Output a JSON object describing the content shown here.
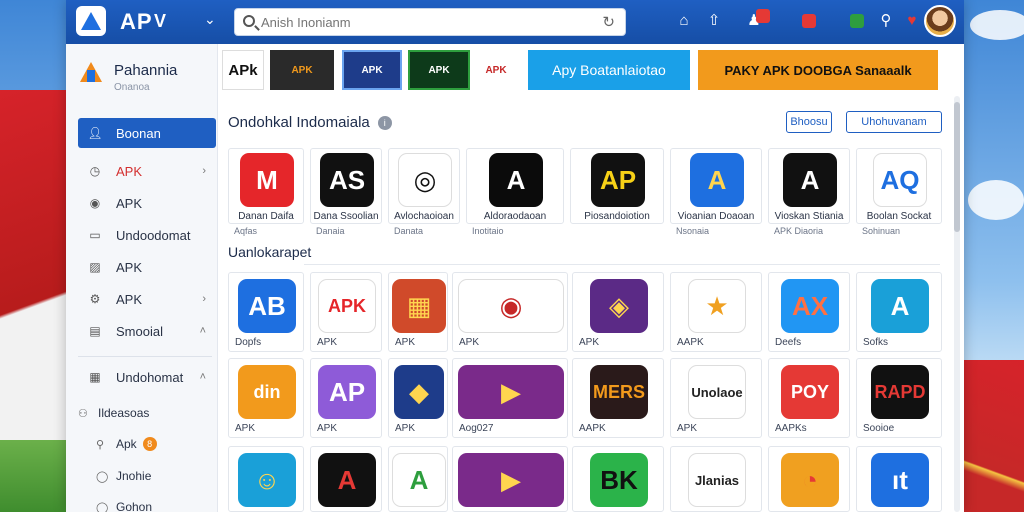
{
  "topbar": {
    "title": "AP",
    "search_placeholder": "Anish Inonianm",
    "title_suffix": "V"
  },
  "sidebar": {
    "brand_name": "Pahannia",
    "brand_sub": "Onanoa",
    "items": [
      {
        "label": "Boonan",
        "icon": "user-icon",
        "active": true
      },
      {
        "label": "APK",
        "icon": "clock-icon",
        "chevron": true,
        "accent": "#d32f2f"
      },
      {
        "label": "APK",
        "icon": "circle-icon"
      },
      {
        "label": "Undoodomat",
        "icon": "folder-icon"
      },
      {
        "label": "APK",
        "icon": "chart-icon"
      },
      {
        "label": "APK",
        "icon": "settings-icon",
        "chevron": true
      },
      {
        "label": "Smooial",
        "icon": "list-icon",
        "chevron_up": true
      }
    ],
    "group": {
      "label": "Undohomat",
      "icon": "calendar-icon"
    },
    "subitems": [
      {
        "label": "Ildeasoas",
        "icon": "people-icon"
      },
      {
        "label": "Apk",
        "icon": "search-icon",
        "badge": "8"
      },
      {
        "label": "Jnohie",
        "icon": "circle-icon"
      },
      {
        "label": "Gohon",
        "icon": "circle-icon"
      }
    ]
  },
  "banner": {
    "tiles": [
      {
        "text": "APk"
      },
      {
        "text": "APK"
      },
      {
        "text": "APK"
      },
      {
        "text": "APK"
      },
      {
        "text": "APK"
      },
      {
        "text": "Apy  Boatanlaiotao"
      },
      {
        "text": "PAKY  APK DOOBGA  Sanaaalk"
      }
    ]
  },
  "section1": {
    "title": "Ondohkal Indomaiala",
    "info": "i",
    "btn1": "Bhoosu",
    "btn2": "Uhohuvanam",
    "apps": [
      {
        "icon_text": "M",
        "name": "Danan Daifa",
        "sub": "Aqfas",
        "color": "#e5262a",
        "fg": "#ffffff"
      },
      {
        "icon_text": "AS",
        "name": "Dana Ssoolian",
        "sub": "Danaia",
        "color": "#111111",
        "fg": "#ffffff"
      },
      {
        "icon_text": "◎",
        "name": "Avlochaoioan",
        "sub": "Danata",
        "color": "#ffffff",
        "fg": "#111111"
      },
      {
        "icon_text": "A",
        "name": "Aldoraodaoan",
        "sub": "Inotitaio",
        "color": "#0b0b0b",
        "fg": "#ffffff"
      },
      {
        "icon_text": "AP",
        "name": "Piosandoiotion",
        "sub": "",
        "color": "#111111",
        "fg": "#f7d117"
      },
      {
        "icon_text": "A",
        "name": "Vioanian Doaoan",
        "sub": "Nsonaia",
        "color": "#1e6fe0",
        "fg": "#ffd54f"
      },
      {
        "icon_text": "A",
        "name": "Vioskan Stiania",
        "sub": "APK Diaoria",
        "color": "#111111",
        "fg": "#ffffff"
      },
      {
        "icon_text": "AQ",
        "name": "Boolan Sockat",
        "sub": "Sohinuan",
        "color": "#ffffff",
        "fg": "#1e6fe0"
      }
    ]
  },
  "section2": {
    "title": "Uanlokarapet",
    "rows": [
      [
        {
          "icon_text": "AB",
          "label": "Dopfs",
          "color": "#1e6fe0",
          "fg": "#ffffff"
        },
        {
          "icon_text": "APK",
          "label": "APK",
          "color": "#ffffff",
          "fg": "#e5262a"
        },
        {
          "icon_text": "▦",
          "label": "APK",
          "color": "#d04a2a",
          "fg": "#ffd54f"
        },
        {
          "icon_text": "◉",
          "label": "APK",
          "color": "#ffffff",
          "fg": "#c62828"
        },
        {
          "icon_text": "◈",
          "label": "APK",
          "color": "#5b2a86",
          "fg": "#ffd54f"
        },
        {
          "icon_text": "★",
          "label": "AAPK",
          "color": "#ffffff",
          "fg": "#f0a020"
        },
        {
          "icon_text": "AX",
          "label": "Deefs",
          "color": "#2196f3",
          "fg": "#ff7043"
        },
        {
          "icon_text": "A",
          "label": "Sofks",
          "color": "#1aa0d8",
          "fg": "#ffffff"
        }
      ],
      [
        {
          "icon_text": "din",
          "label": "APK",
          "color": "#f29a1c",
          "fg": "#ffffff"
        },
        {
          "icon_text": "AP",
          "label": "APK",
          "color": "#8e5bd8",
          "fg": "#ffffff"
        },
        {
          "icon_text": "◆",
          "label": "APK",
          "color": "#1e3c8a",
          "fg": "#ffd54f"
        },
        {
          "icon_text": "▶",
          "label": "Aog027",
          "color": "#7a2a8a",
          "fg": "#ffd54f"
        },
        {
          "icon_text": "MERS",
          "label": "AAPK",
          "color": "#2a1a1a",
          "fg": "#f29a1c"
        },
        {
          "icon_text": "Unolaoe",
          "label": "APK",
          "color": "#ffffff",
          "fg": "#222222"
        },
        {
          "icon_text": "POY",
          "label": "AAPKs",
          "color": "#e53935",
          "fg": "#ffffff"
        },
        {
          "icon_text": "RAPD",
          "label": "Sooioe",
          "color": "#111111",
          "fg": "#e53935"
        }
      ],
      [
        {
          "icon_text": "☺",
          "label": "",
          "color": "#1aa0d8",
          "fg": "#ffd54f"
        },
        {
          "icon_text": "A",
          "label": "",
          "color": "#111111",
          "fg": "#e53935"
        },
        {
          "icon_text": "A",
          "label": "",
          "color": "#ffffff",
          "fg": "#2e9e3e"
        },
        {
          "icon_text": "▶",
          "label": "",
          "color": "#7a2a8a",
          "fg": "#ffd54f"
        },
        {
          "icon_text": "BK",
          "label": "",
          "color": "#2bb34a",
          "fg": "#111111"
        },
        {
          "icon_text": "Jlanias",
          "label": "",
          "color": "#ffffff",
          "fg": "#222222"
        },
        {
          "icon_text": "◔",
          "label": "",
          "color": "#f0a020",
          "fg": "#e53935"
        },
        {
          "icon_text": "ıt",
          "label": "",
          "color": "#1e6fe0",
          "fg": "#ffffff"
        }
      ]
    ]
  },
  "colors": {
    "topbar": "#1f5fc2",
    "accent": "#1f5fc2",
    "orange": "#f08a1c"
  }
}
